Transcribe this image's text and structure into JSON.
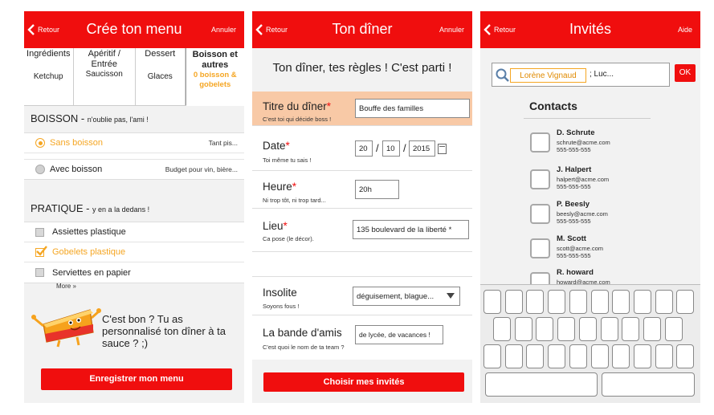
{
  "screen1": {
    "back_label": "Retour",
    "title": "Crée ton menu",
    "right_label": "Annuler",
    "tabs": [
      {
        "name": "Ingrédients",
        "value": "Ketchup"
      },
      {
        "name": "Apéritif / Entrée",
        "value": "Saucisson"
      },
      {
        "name": "Dessert",
        "value": "Glaces"
      },
      {
        "name": "Boisson et autres",
        "value": "0 boisson & gobelets"
      }
    ],
    "boisson_heading": "BOISSON - ",
    "boisson_sub": "n'oublie pas, l'ami !",
    "boisson_options": [
      {
        "label": "Sans boisson",
        "note": "Tant pis..."
      },
      {
        "label": "Avec boisson",
        "note": "Budget pour vin, bière..."
      }
    ],
    "pratique_heading": "PRATIQUE - ",
    "pratique_sub": "y en a la dedans !",
    "pratique_options": [
      {
        "label": "Assiettes plastique"
      },
      {
        "label": "Gobelets plastique"
      },
      {
        "label": "Serviettes en papier"
      }
    ],
    "more_label": "More »",
    "promo_text": "C'est bon ? Tu as personnalisé ton dîner à ta sauce ? ;)",
    "save_button": "Enregistrer mon menu"
  },
  "screen2": {
    "back_label": "Retour",
    "title": "Ton dîner",
    "right_label": "Annuler",
    "heading": "Ton dîner, tes règles ! C'est parti !",
    "fields": {
      "titre": {
        "label": "Titre du dîner",
        "sub": "C'est toi qui décide boss !",
        "value": "Bouffe des familles"
      },
      "date": {
        "label": "Date",
        "sub": "Toi même tu sais !",
        "day": "20",
        "month": "10",
        "year": "2015",
        "sep": "/"
      },
      "heure": {
        "label": "Heure",
        "sub": "Ni trop tôt, ni trop tard...",
        "value": "20h"
      },
      "lieu": {
        "label": "Lieu",
        "sub": "Ca pose (le décor).",
        "value": "135 boulevard de la liberté *"
      },
      "insolite": {
        "label": "Insolite",
        "sub": "Soyons fous !",
        "value": "déguisement, blague..."
      },
      "bande": {
        "label": "La bande d'amis",
        "sub": "C'est quoi le nom de ta team ?",
        "value": "de lycée, de vacances !"
      }
    },
    "required_mark": "*",
    "invite_button": "Choisir mes invités"
  },
  "screen3": {
    "back_label": "Retour",
    "title": "Invités",
    "right_label": "Aide",
    "search_tag": "Lorène Vignaud",
    "search_rest": "; Luc...",
    "ok_label": "OK",
    "contacts_heading": "Contacts",
    "contacts": [
      {
        "name": "D. Schrute",
        "email": "schrute@acme.com",
        "phone": "555-555-555"
      },
      {
        "name": "J. Halpert",
        "email": "halpert@acme.com",
        "phone": "555-555-555"
      },
      {
        "name": "P. Beesly",
        "email": "beesly@acme.com",
        "phone": "555-555-555"
      },
      {
        "name": "M. Scott",
        "email": "scott@acme.com",
        "phone": "555-555-555"
      },
      {
        "name": "R. howard",
        "email": "howard@acme.com",
        "phone": ""
      }
    ]
  },
  "colors": {
    "accent_red": "#f00e0e",
    "highlight_orange": "#f5a623",
    "row_highlight": "#f8c9a6"
  }
}
